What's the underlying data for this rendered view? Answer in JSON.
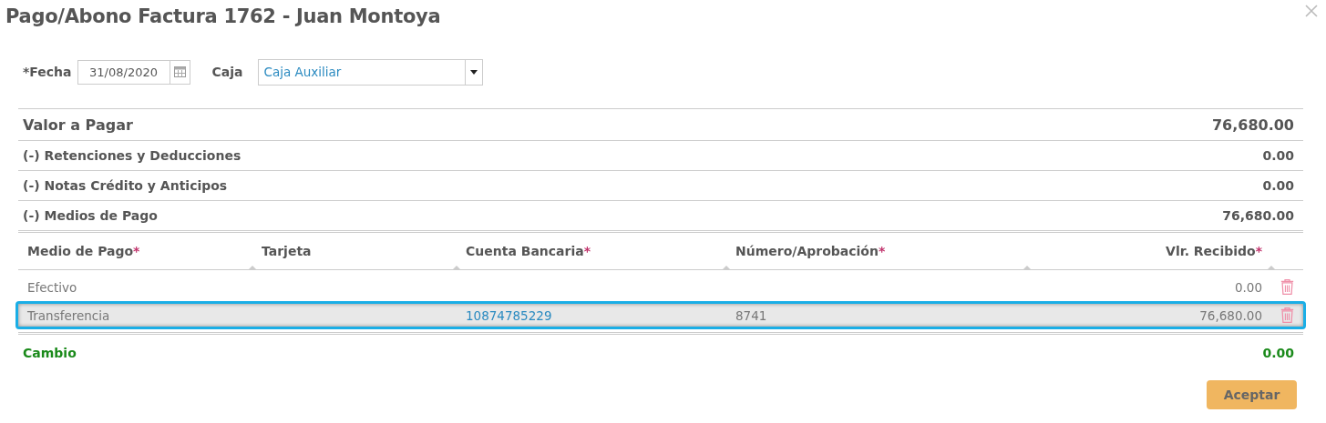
{
  "window": {
    "title": "Pago/Abono Factura 1762 - Juan Montoya"
  },
  "form": {
    "fecha_label": "*Fecha",
    "fecha_value": "31/08/2020",
    "caja_label": "Caja",
    "caja_value": "Caja Auxiliar"
  },
  "summary": [
    {
      "label": "Valor a Pagar",
      "value": "76,680.00",
      "kind": "total"
    },
    {
      "label": "(-) Retenciones y Deducciones",
      "value": "0.00",
      "kind": "line"
    },
    {
      "label": "(-) Notas Crédito y Anticipos",
      "value": "0.00",
      "kind": "line"
    },
    {
      "label": "(-) Medios de Pago",
      "value": "76,680.00",
      "kind": "line"
    }
  ],
  "table": {
    "columns": [
      {
        "label": "Medio de Pago",
        "mark": "*"
      },
      {
        "label": "Tarjeta"
      },
      {
        "label": "Cuenta Bancaria",
        "mark": "*"
      },
      {
        "label": "Número/Aprobación",
        "mark": "*"
      },
      {
        "label": "Vlr. Recibido",
        "mark": "*"
      }
    ],
    "rows": [
      {
        "cells": [
          "Efectivo",
          "",
          "",
          "",
          "0.00"
        ],
        "selected": false
      },
      {
        "cells": [
          "Transferencia",
          "",
          "10874785229",
          "8741",
          "76,680.00"
        ],
        "selected": true
      }
    ]
  },
  "cambio": {
    "label": "Cambio",
    "value": "0.00"
  },
  "buttons": [
    "Aceptar"
  ]
}
